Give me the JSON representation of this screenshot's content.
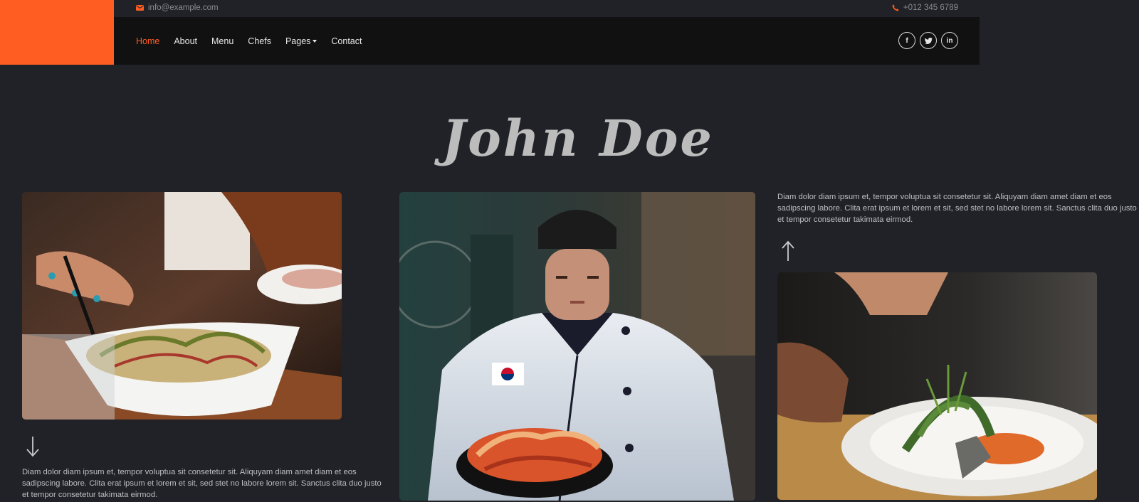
{
  "topbar": {
    "email": "info@example.com",
    "phone": "+012 345 6789",
    "email_icon": "envelope-icon",
    "phone_icon": "phone-icon"
  },
  "nav": {
    "items": [
      {
        "label": "Home",
        "active": true
      },
      {
        "label": "About"
      },
      {
        "label": "Menu"
      },
      {
        "label": "Chefs"
      },
      {
        "label": "Pages",
        "dropdown": true
      },
      {
        "label": "Contact"
      }
    ]
  },
  "socials": [
    {
      "icon": "facebook-icon",
      "glyph": "f"
    },
    {
      "icon": "twitter-icon",
      "glyph": "t"
    },
    {
      "icon": "linkedin-icon",
      "glyph": "in"
    }
  ],
  "hero": {
    "title": "John Doe"
  },
  "descriptions": {
    "left": "Diam dolor diam ipsum et, tempor voluptua sit consetetur sit. Aliquyam diam amet diam et eos sadipscing labore. Clita erat ipsum et lorem et sit, sed stet no labore lorem sit. Sanctus clita duo justo et tempor consetetur takimata eirmod.",
    "right": "Diam dolor diam ipsum et, tempor voluptua sit consetetur sit. Aliquyam diam amet diam et eos sadipscing labore. Clita erat ipsum et lorem et sit, sed stet no labore lorem sit. Sanctus clita duo justo et tempor consetetur takimata eirmod."
  },
  "colors": {
    "accent": "#ff5d22",
    "background": "#212228",
    "navbar": "#111111"
  }
}
